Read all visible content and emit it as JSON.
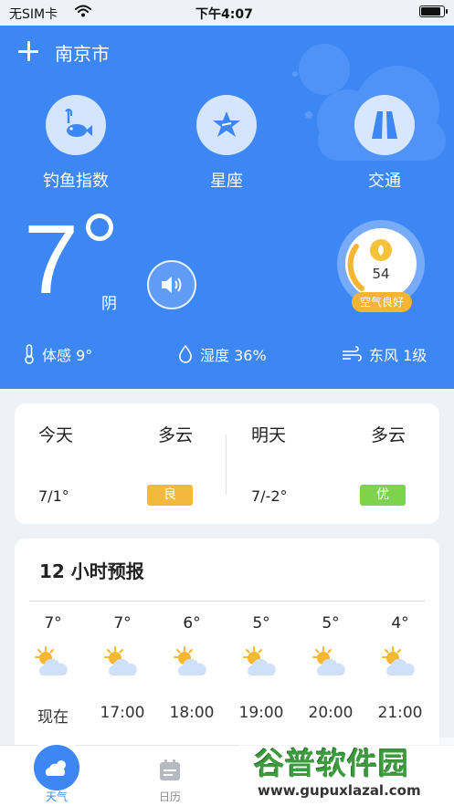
{
  "status_bar": {
    "carrier": "无SIM卡",
    "time": "下午4:07"
  },
  "header": {
    "city": "南京市"
  },
  "shortcuts": [
    {
      "label": "钓鱼指数",
      "icon": "fishing-icon"
    },
    {
      "label": "星座",
      "icon": "star-icon"
    },
    {
      "label": "交通",
      "icon": "road-icon"
    }
  ],
  "current": {
    "temperature": "7",
    "condition": "阴"
  },
  "air_quality": {
    "value": "54",
    "label": "空气良好"
  },
  "metrics": {
    "feels_like": "体感 9°",
    "humidity": "湿度 36%",
    "wind": "东风 1级"
  },
  "days": [
    {
      "name": "今天",
      "sky": "多云",
      "range": "7/1°",
      "badge": "良",
      "badge_color": "#f2b93c"
    },
    {
      "name": "明天",
      "sky": "多云",
      "range": "7/-2°",
      "badge": "优",
      "badge_color": "#7ed34c"
    }
  ],
  "forecast": {
    "title": "12 小时预报",
    "hours": [
      {
        "temp": "7°",
        "time": "现在"
      },
      {
        "temp": "7°",
        "time": "17:00"
      },
      {
        "temp": "6°",
        "time": "18:00"
      },
      {
        "temp": "5°",
        "time": "19:00"
      },
      {
        "temp": "5°",
        "time": "20:00"
      },
      {
        "temp": "4°",
        "time": "21:00"
      }
    ]
  },
  "tabs": [
    {
      "label": "天气",
      "icon": "weather-icon",
      "active": true
    },
    {
      "label": "日历",
      "icon": "calendar-icon",
      "active": false
    }
  ],
  "watermark": {
    "title": "谷普软件园",
    "url": "www.gupuxlazal.com"
  },
  "colors": {
    "primary": "#3d87f5",
    "aqi": "#f5b533"
  }
}
